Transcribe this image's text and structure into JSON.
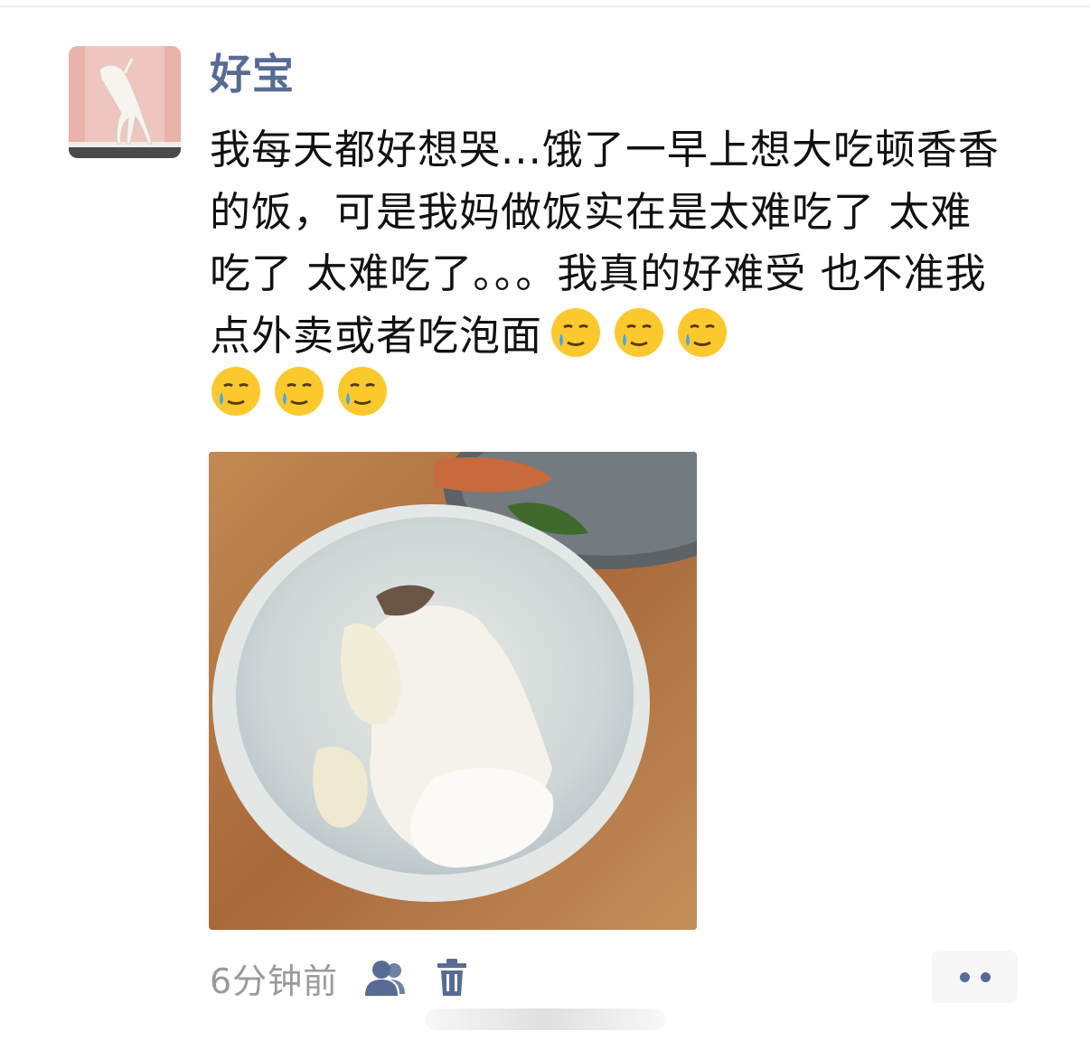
{
  "post": {
    "author": "好宝",
    "text": "我每天都好想哭...饿了一早上想大吃顿香香的饭，可是我妈做饭实在是太难吃了 太难吃了 太难吃了。。。我真的好难受 也不准我点外卖或者吃泡面",
    "emojis": [
      "crying-smile-emoji",
      "crying-smile-emoji",
      "crying-smile-emoji",
      "crying-smile-emoji",
      "crying-smile-emoji",
      "crying-smile-emoji"
    ],
    "image_icon": "photo-rice-bowl",
    "timestamp": "6分钟前"
  },
  "icons": {
    "privacy": "friends-visibility-icon",
    "delete": "trash-icon",
    "more": "more-dots-icon"
  },
  "colors": {
    "name_blue": "#576b95",
    "text": "#111111",
    "muted": "#9a9a9a"
  }
}
